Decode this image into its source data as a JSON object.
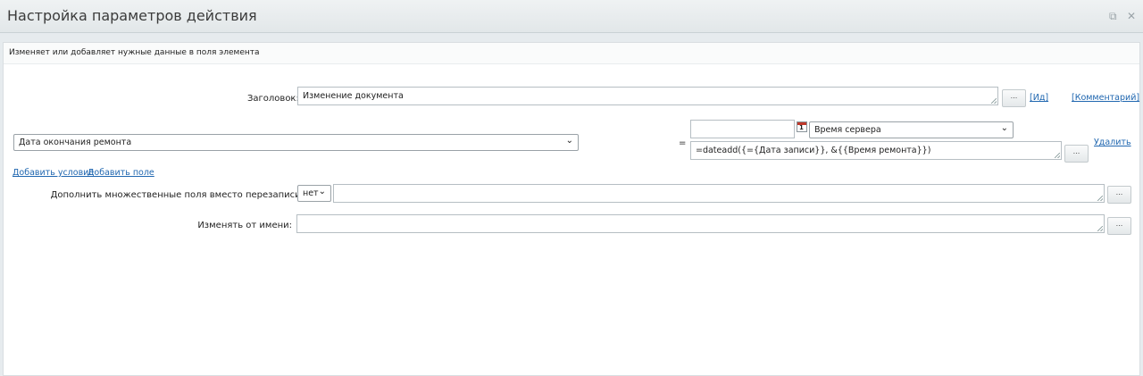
{
  "window": {
    "title": "Настройка параметров действия",
    "restore_icon": "restore-window-icon",
    "close_icon": "close-icon"
  },
  "description": "Изменяет или добавляет нужные данные в поля элемента",
  "header_field": {
    "label": "Заголовок:",
    "value": "Изменение документа",
    "dots_label": "...",
    "id_link": "[Ид]",
    "comment_link": "[Комментарий]"
  },
  "condition": {
    "field_select": "Дата окончания ремонта",
    "equals": "=",
    "date_input": "",
    "timezone_select": "Время сервера",
    "formula": "=dateadd({={Дата записи}}, &{{Время ремонта}})",
    "formula_dots": "...",
    "delete_link": "Удалить"
  },
  "actions": {
    "add_condition": "Добавить условие",
    "add_field": "Добавить поле"
  },
  "append_multiple": {
    "label": "Дополнить множественные поля вместо перезаписи:",
    "select_value": "нет",
    "value": "",
    "dots_label": "..."
  },
  "modify_as": {
    "label": "Изменять от имени:",
    "value": "",
    "dots_label": "..."
  }
}
